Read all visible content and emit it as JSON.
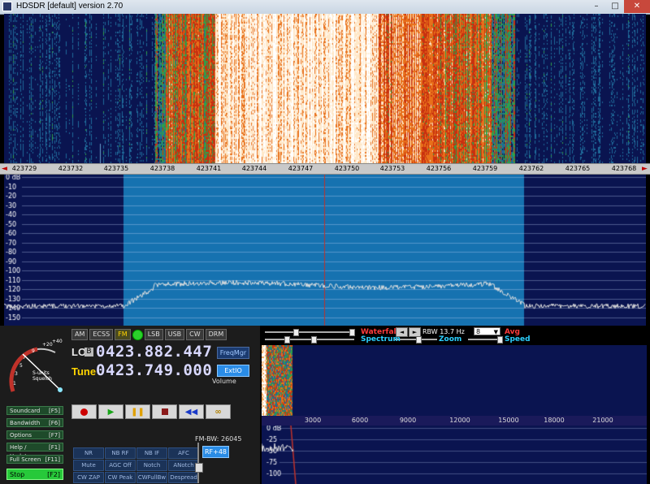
{
  "window": {
    "title": "HDSDR  [default]   version 2.70",
    "minimize_glyph": "–",
    "maximize_glyph": "□",
    "close_glyph": "✕"
  },
  "frequency_axis": {
    "ticks": [
      "423729",
      "423732",
      "423735",
      "423738",
      "423741",
      "423744",
      "423747",
      "423750",
      "423753",
      "423756",
      "423759",
      "423762",
      "423765",
      "423768"
    ]
  },
  "spectrum": {
    "db_labels": [
      "0 dB",
      "-10",
      "-20",
      "-30",
      "-40",
      "-50",
      "-60",
      "-70",
      "-80",
      "-90",
      "-100",
      "-110",
      "-120",
      "-130",
      "-140",
      "-150"
    ],
    "colors": {
      "background": "#0a1450",
      "filter": "#1672b0",
      "trace": "#e0e0e0",
      "marker": "#c0322a"
    }
  },
  "modes": [
    {
      "label": "AM",
      "active": false
    },
    {
      "label": "ECSS",
      "active": false
    },
    {
      "label": "FM",
      "active": true
    },
    {
      "label": "LSB",
      "active": false
    },
    {
      "label": "USB",
      "active": false
    },
    {
      "label": "CW",
      "active": false
    },
    {
      "label": "DRM",
      "active": false
    }
  ],
  "lo": {
    "label": "LO",
    "bank": "B",
    "frequency": "0423.882.447"
  },
  "tune": {
    "label": "Tune",
    "frequency": "0423.749.000"
  },
  "buttons": {
    "freqmgr": "FreqMgr",
    "extio": "ExtIO",
    "volume": "Volume",
    "rf": "RF+48"
  },
  "smeter": {
    "scale": [
      "1",
      "3",
      "5",
      "7",
      "9",
      "+20",
      "+40"
    ],
    "label_line1": "S-units",
    "label_line2": "Squelch"
  },
  "side_buttons": [
    {
      "label": "Soundcard",
      "key": "[F5]"
    },
    {
      "label": "Bandwidth",
      "key": "[F6]"
    },
    {
      "label": "Options",
      "key": "[F7]"
    },
    {
      "label": "Help / Update",
      "key": "[F1]"
    },
    {
      "label": "Full Screen",
      "key": "[F11]"
    }
  ],
  "stop_button": {
    "label": "Stop",
    "key": "[F2]"
  },
  "transport": [
    "record",
    "play",
    "pause",
    "stop",
    "rewind",
    "loop"
  ],
  "fm_bw": "FM-BW: 26045",
  "dsp_buttons": [
    [
      "NR",
      "NB RF",
      "NB IF",
      "AFC"
    ],
    [
      "Mute",
      "AGC Off",
      "Notch",
      "ANotch"
    ],
    [
      "CW ZAP",
      "CW Peak",
      "CWFullBw",
      "Despread"
    ]
  ],
  "display_controls": {
    "waterfall": "Waterfall",
    "spectrum": "Spectrum",
    "zoom": "Zoom",
    "rbw": "RBW 13.7 Hz",
    "avg_value": "8",
    "avg": "Avg",
    "speed": "Speed"
  },
  "audio_axis": {
    "ticks": [
      "3000",
      "6000",
      "9000",
      "12000",
      "15000",
      "18000",
      "21000"
    ]
  },
  "audio_spectrum": {
    "db_labels": [
      "0 dB",
      "-25",
      "-50",
      "-75",
      "-100"
    ]
  }
}
